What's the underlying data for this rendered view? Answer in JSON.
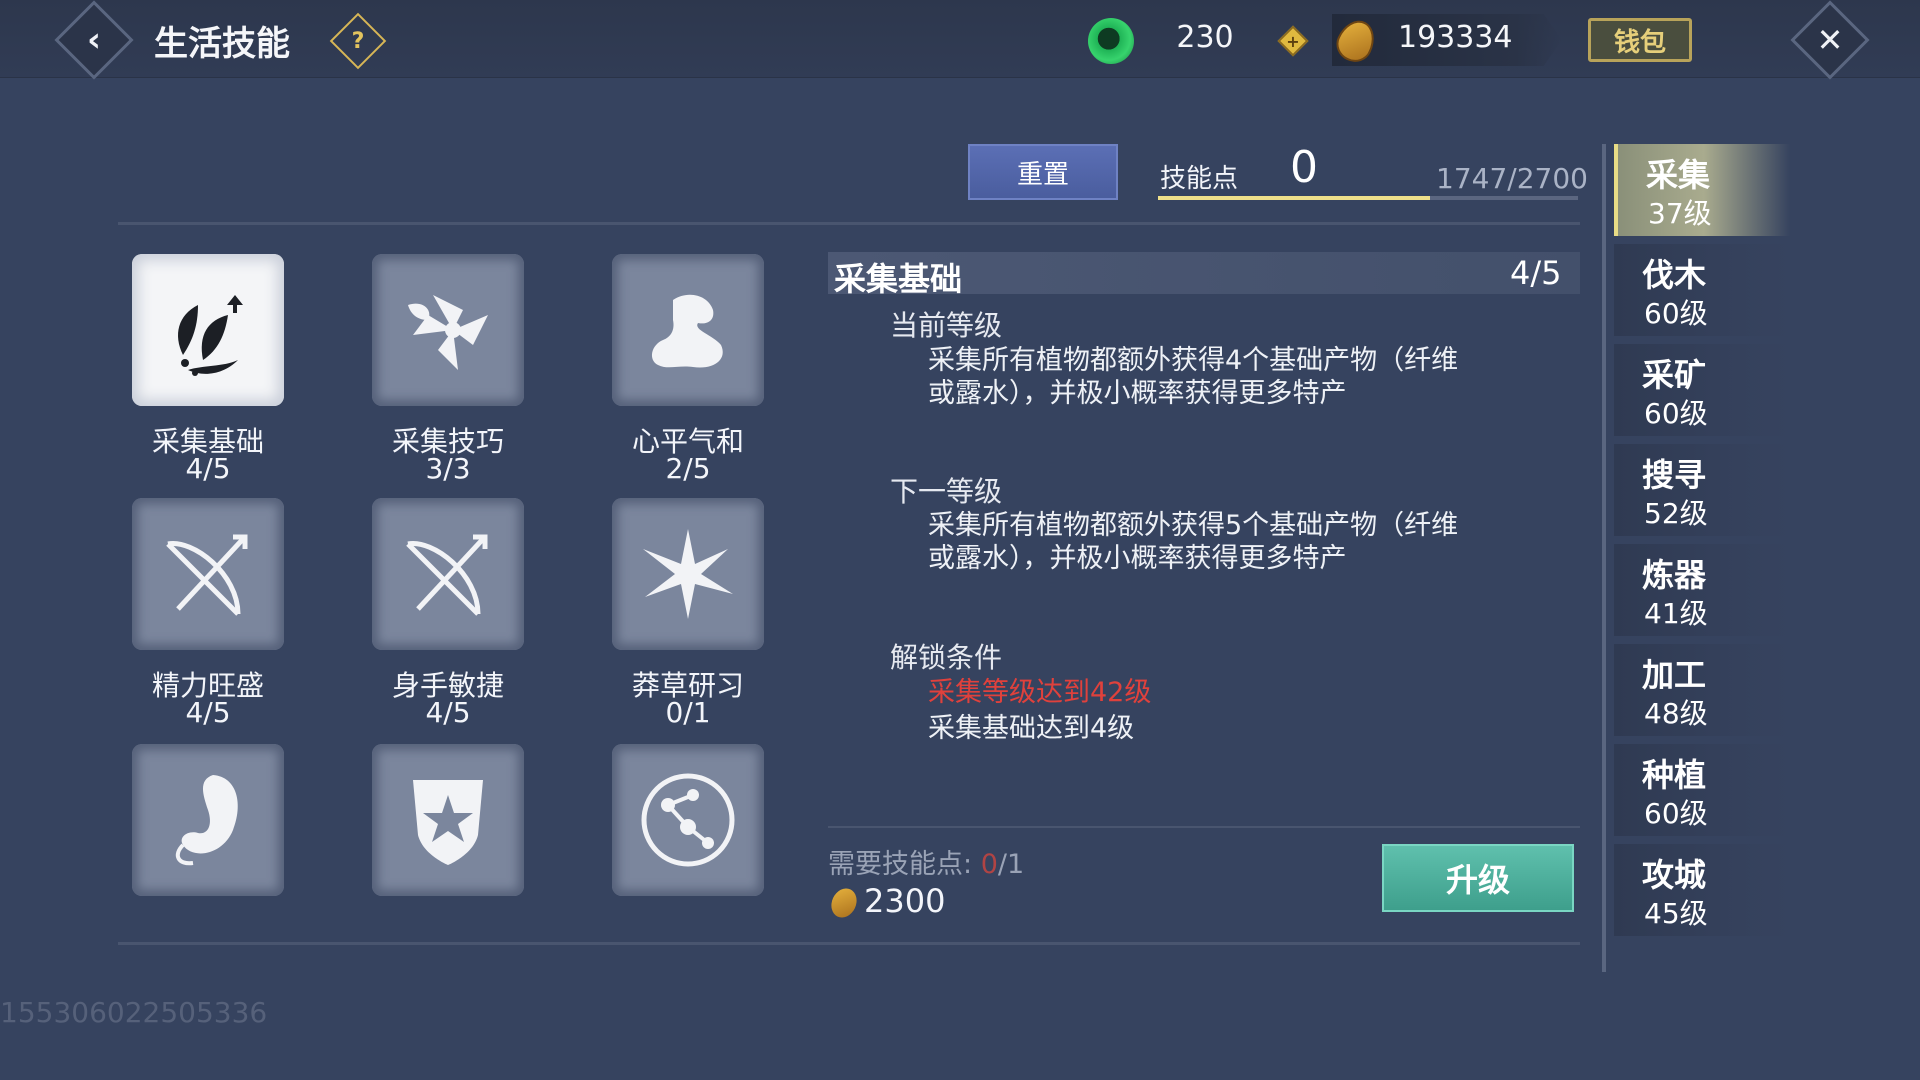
{
  "header": {
    "title": "生活技能",
    "jade_amount": "230",
    "coin_amount": "193334",
    "wallet_label": "钱包"
  },
  "skill_panel": {
    "reset_label": "重置",
    "skill_points_label": "技能点",
    "skill_points_value": "0",
    "xp_text": "1747/2700",
    "xp_progress": 0.647
  },
  "skills": [
    {
      "name": "采集基础",
      "level": "4/5",
      "icon": "leaf-herb-icon"
    },
    {
      "name": "采集技巧",
      "level": "3/3",
      "icon": "flower-icon"
    },
    {
      "name": "心平气和",
      "level": "2/5",
      "icon": "muscle-arm-icon"
    },
    {
      "name": "精力旺盛",
      "level": "4/5",
      "icon": "bow-arrow-icon"
    },
    {
      "name": "身手敏捷",
      "level": "4/5",
      "icon": "bow-arrow-icon"
    },
    {
      "name": "莽草研习",
      "level": "0/1",
      "icon": "spiky-flower-icon"
    },
    {
      "name": "",
      "level": "",
      "icon": "stomach-icon"
    },
    {
      "name": "",
      "level": "",
      "icon": "star-shield-icon"
    },
    {
      "name": "",
      "level": "",
      "icon": "constellation-icon"
    }
  ],
  "detail": {
    "title": "采集基础",
    "level": "4/5",
    "current_title": "当前等级",
    "current_text": "采集所有植物都额外获得4个基础产物（纤维或露水），并极小概率获得更多特产",
    "next_title": "下一等级",
    "next_text": "采集所有植物都额外获得5个基础产物（纤维或露水），并极小概率获得更多特产",
    "unlock_title": "解锁条件",
    "unlock_conditions": [
      "采集等级达到42级",
      "采集基础达到4级"
    ],
    "cost_label": "需要技能点:",
    "cost_have": "0",
    "cost_need": "/1",
    "gold_cost": "2300",
    "upgrade_label": "升级"
  },
  "tabs": [
    {
      "name": "采集",
      "level": "37级",
      "active": true
    },
    {
      "name": "伐木",
      "level": "60级"
    },
    {
      "name": "采矿",
      "level": "60级"
    },
    {
      "name": "搜寻",
      "level": "52级"
    },
    {
      "name": "炼器",
      "level": "41级"
    },
    {
      "name": "加工",
      "level": "48级"
    },
    {
      "name": "种植",
      "level": "60级"
    },
    {
      "name": "攻城",
      "level": "45级"
    }
  ],
  "footer_id": "155306022505336",
  "colors": {
    "accent_gold": "#e3c45e",
    "upgrade_green": "#4fb09d",
    "warning_red": "#e0413c"
  }
}
